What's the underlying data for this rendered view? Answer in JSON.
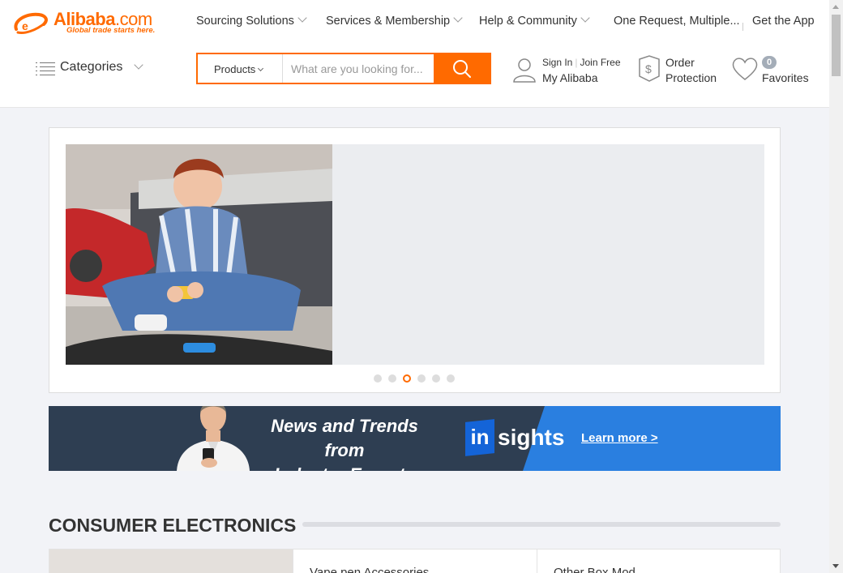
{
  "brand": {
    "name": "Alibaba",
    "domain_suffix": ".com",
    "tagline": "Global trade starts here.",
    "accent_color": "#ff6a00"
  },
  "topnav": {
    "items": [
      {
        "label": "Sourcing Solutions",
        "has_dropdown": true
      },
      {
        "label": "Services & Membership",
        "has_dropdown": true
      },
      {
        "label": "Help & Community",
        "has_dropdown": true
      },
      {
        "label": "One Request, Multiple...",
        "has_dropdown": false
      },
      {
        "label": "Get the App",
        "has_dropdown": false
      }
    ]
  },
  "categories": {
    "label": "Categories",
    "icon": "menu-list-icon"
  },
  "search": {
    "scope": "Products",
    "placeholder": "What are you looking for...",
    "button_icon": "search-icon"
  },
  "account": {
    "sign_in": "Sign In",
    "join": "Join Free",
    "my": "My Alibaba",
    "icon": "user-icon"
  },
  "order_protection": {
    "line1": "Order",
    "line2": "Protection",
    "icon": "shield-dollar-icon"
  },
  "favorites": {
    "count": "0",
    "label": "Favorites",
    "icon": "heart-icon"
  },
  "carousel": {
    "slide_count": 6,
    "active_index": 2,
    "image": "boy-with-rc-car-photo"
  },
  "insights_banner": {
    "headline_line1": "News and Trends from",
    "headline_line2": "Industry Experts",
    "brand_in": "in",
    "brand_rest": "sights",
    "link": "Learn more >",
    "colors": {
      "dark": "#2e3e52",
      "blue": "#2a7fe0"
    }
  },
  "section": {
    "title": "CONSUMER ELECTRONICS",
    "cards": [
      {
        "label": "Vape pen Accessories"
      },
      {
        "label": "Other Box Mod"
      }
    ]
  }
}
